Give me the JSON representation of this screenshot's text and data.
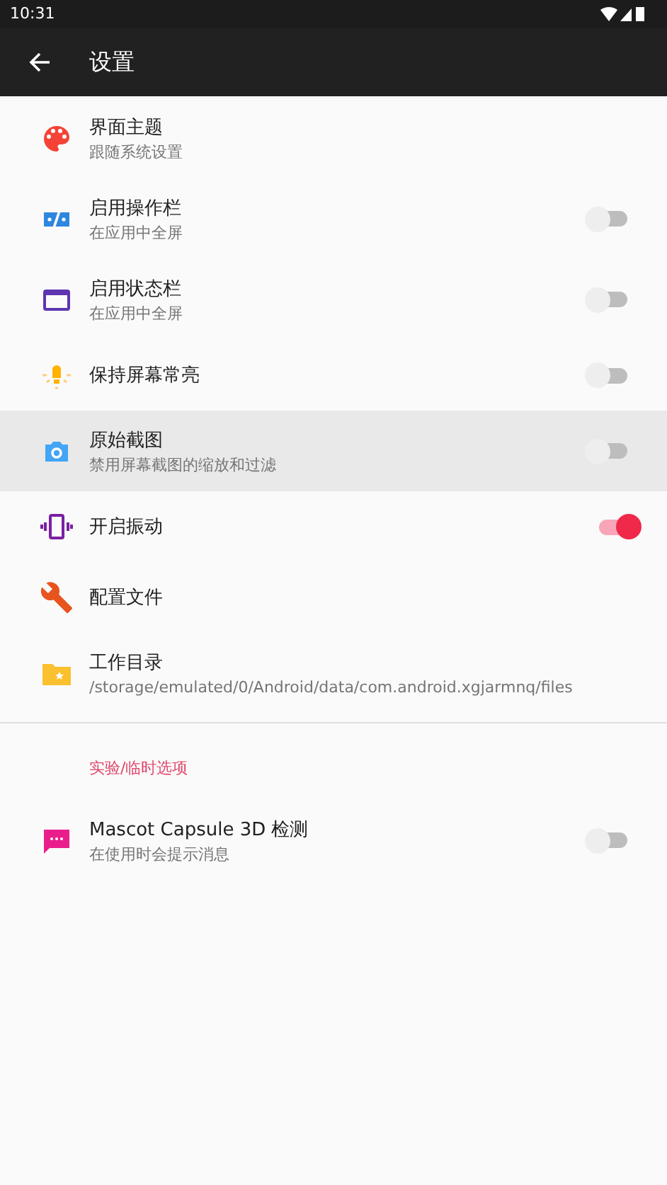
{
  "status_bar": {
    "time": "10:31"
  },
  "toolbar": {
    "title": "设置"
  },
  "items": [
    {
      "kind": "palette",
      "title": "界面主题",
      "subtitle": "跟随系统设置",
      "highlighted": false
    },
    {
      "kind": "actionbar",
      "title": "启用操作栏",
      "subtitle": "在应用中全屏",
      "switch_on": false,
      "highlighted": false
    },
    {
      "kind": "statusbar",
      "title": "启用状态栏",
      "subtitle": "在应用中全屏",
      "switch_on": false,
      "highlighted": false
    },
    {
      "kind": "bulb",
      "title": "保持屏幕常亮",
      "switch_on": false,
      "highlighted": false
    },
    {
      "kind": "camera",
      "title": "原始截图",
      "subtitle": "禁用屏幕截图的缩放和过滤",
      "switch_on": false,
      "highlighted": true
    },
    {
      "kind": "vibration",
      "title": "开启振动",
      "switch_on": true,
      "highlighted": false
    },
    {
      "kind": "wrench",
      "title": "配置文件",
      "highlighted": false
    },
    {
      "kind": "folder",
      "title": "工作目录",
      "subtitle": "/storage/emulated/0/Android/data/com.android.xgjarmnq/files",
      "highlighted": false
    }
  ],
  "section": {
    "header": "实验/临时选项",
    "items": [
      {
        "kind": "message",
        "title": "Mascot Capsule 3D 检测",
        "subtitle": "在使用时会提示消息",
        "switch_on": false,
        "highlighted": false
      }
    ]
  }
}
